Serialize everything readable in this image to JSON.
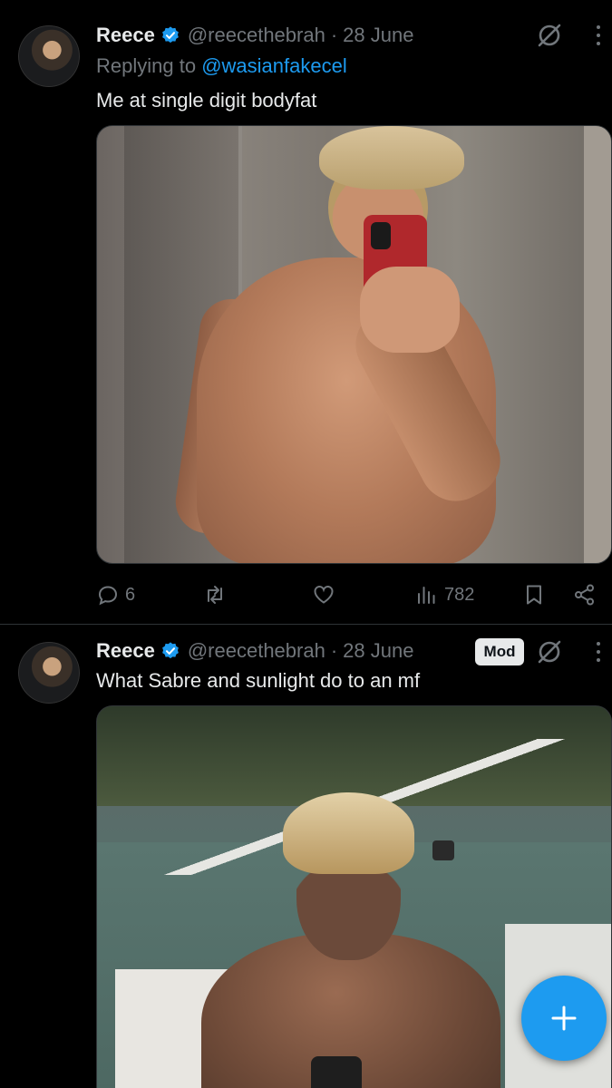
{
  "tweets": [
    {
      "author_name": "Reece",
      "handle": "@reecethebrah",
      "separator": "·",
      "date": "28 June",
      "replying_prefix": "Replying to",
      "replying_to": "@wasianfakecel",
      "text": "Me at single digit bodyfat",
      "replies": "6",
      "views": "782"
    },
    {
      "author_name": "Reece",
      "handle": "@reecethebrah",
      "separator": "·",
      "date": "28 June",
      "badge": "Mod",
      "text": "What Sabre and sunlight do to an mf"
    }
  ],
  "colors": {
    "background": "#000000",
    "primary_text": "#e7e9ea",
    "secondary_text": "#71767b",
    "accent": "#1d9bf0",
    "divider": "#2f3336"
  },
  "icons": {
    "verified": "verified-badge-icon",
    "grok": "grok-icon",
    "more": "more-vertical-icon",
    "reply": "reply-icon",
    "retweet": "retweet-icon",
    "like": "heart-icon",
    "views": "views-icon",
    "bookmark": "bookmark-icon",
    "share": "share-icon",
    "compose": "plus-icon"
  }
}
